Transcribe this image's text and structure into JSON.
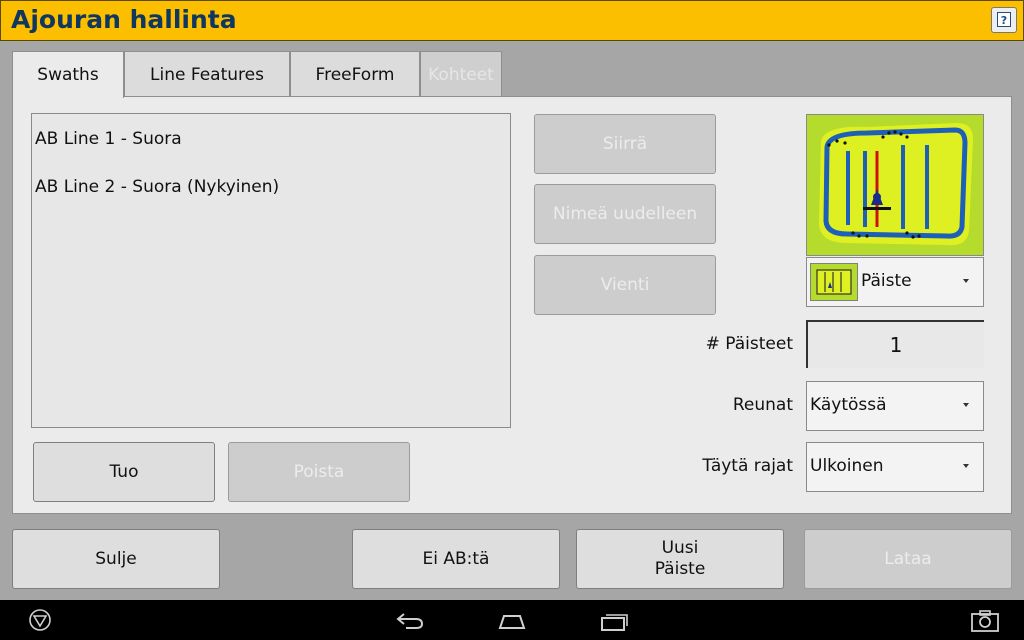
{
  "title": "Ajouran hallinta",
  "help_icon": "help-icon",
  "tabs": [
    {
      "label": "Swaths",
      "state": "active"
    },
    {
      "label": "Line Features",
      "state": "normal"
    },
    {
      "label": "FreeForm",
      "state": "normal"
    },
    {
      "label": "Kohteet",
      "state": "disabled"
    }
  ],
  "swath_list": [
    "AB Line 1 - Suora",
    "AB Line 2 - Suora (Nykyinen)"
  ],
  "actions": {
    "move": "Siirrä",
    "rename": "Nimeä uudelleen",
    "export": "Vienti",
    "import": "Tuo",
    "delete": "Poista"
  },
  "pattern": {
    "selected": "Päiste",
    "icon": "headland-pattern-icon"
  },
  "fields": {
    "headlands_label": "# Päisteet",
    "headlands_value": "1",
    "edges_label": "Reunat",
    "edges_value": "Käytössä",
    "fill_label": "Täytä rajat",
    "fill_value": "Ulkoinen"
  },
  "footer": {
    "close": "Sulje",
    "no_ab": "Ei AB:tä",
    "new_line1": "Uusi",
    "new_line2": "Päiste",
    "load": "Lataa"
  },
  "colors": {
    "titlebar": "#fbbf00",
    "title_text": "#103760",
    "field_green": "#b5dc2d",
    "swath_blue": "#1e5fb8"
  },
  "navbar_icons": [
    "app-logo-icon",
    "back-icon",
    "home-icon",
    "recent-apps-icon",
    "screenshot-icon"
  ]
}
